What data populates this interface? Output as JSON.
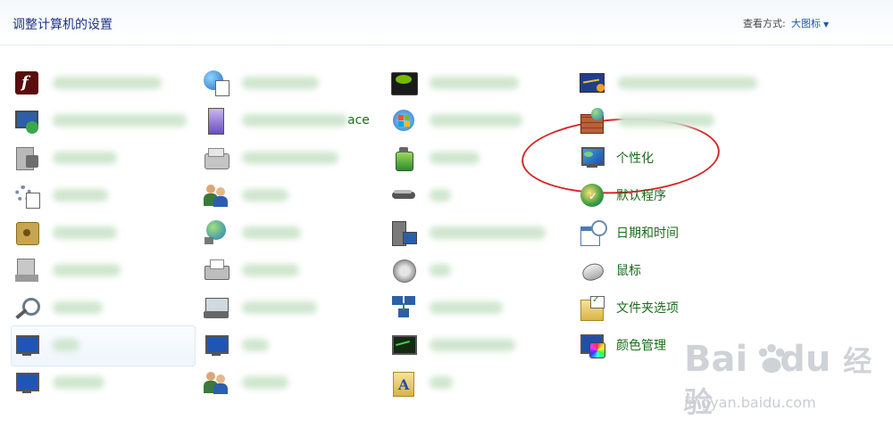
{
  "header": {
    "title": "调整计算机的设置",
    "view_label": "查看方式:",
    "view_value": "大图标"
  },
  "items": {
    "partial_label": "ace",
    "personalization": "个性化",
    "default_programs": "默认程序",
    "date_time": "日期和时间",
    "mouse": "鼠标",
    "folder_options": "文件夹选项",
    "color_management": "颜色管理"
  },
  "watermark": {
    "brand_left": "Bai",
    "brand_right": "du",
    "brand_cn": "经验",
    "url": "jingyan.baidu.com"
  },
  "colors": {
    "link_green": "#1a6b1a",
    "title_blue": "#1e3287",
    "annotation_red": "#d62828"
  }
}
